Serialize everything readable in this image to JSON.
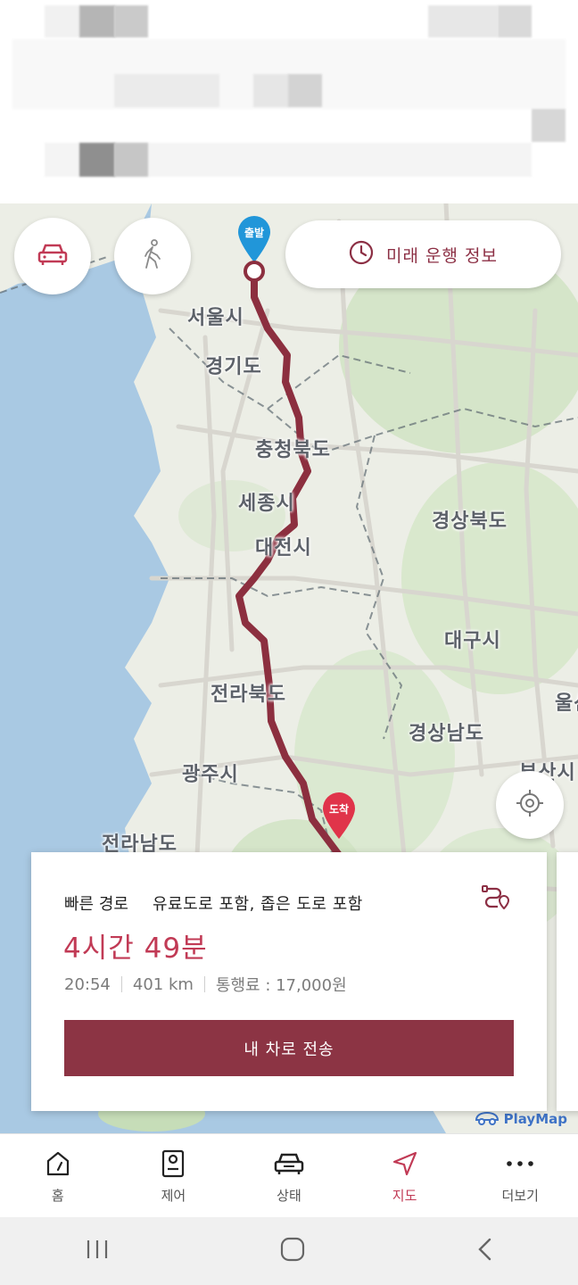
{
  "map": {
    "future_label": "미래 운행 정보",
    "start_pin": "출발",
    "end_pin": "도착",
    "labels": {
      "seoul": "서울시",
      "gyeonggi": "경기도",
      "chungbuk": "충청북도",
      "sejong": "세종시",
      "daejeon": "대전시",
      "gyeongbuk": "경상북도",
      "daegu": "대구시",
      "jeonbuk": "전라북도",
      "gyeongnam": "경상남도",
      "gwangju": "광주시",
      "busan": "부산시",
      "ulsan": "울산",
      "jeonnam": "전라남도"
    },
    "brand": "PlayMap",
    "route_color": "#8c2f3f"
  },
  "route": {
    "type": "빠른 경로",
    "options": "유료도로 포함, 좁은 도로 포함",
    "duration": "4시간 49분",
    "arrival": "20:54",
    "distance": "401 km",
    "toll": "통행료 : 17,000원",
    "send_label": "내 차로 전송"
  },
  "nav": {
    "items": [
      {
        "label": "홈",
        "icon": "home-gauge-icon"
      },
      {
        "label": "제어",
        "icon": "control-icon"
      },
      {
        "label": "상태",
        "icon": "car-status-icon"
      },
      {
        "label": "지도",
        "icon": "navigation-arrow-icon"
      },
      {
        "label": "더보기",
        "icon": "more-icon"
      }
    ]
  },
  "colors": {
    "accent": "#c13a55",
    "button": "#8c3444",
    "start_pin": "#2196d9",
    "end_pin": "#e0344a",
    "sea": "#a9c9e3",
    "land": "#eceee6"
  }
}
